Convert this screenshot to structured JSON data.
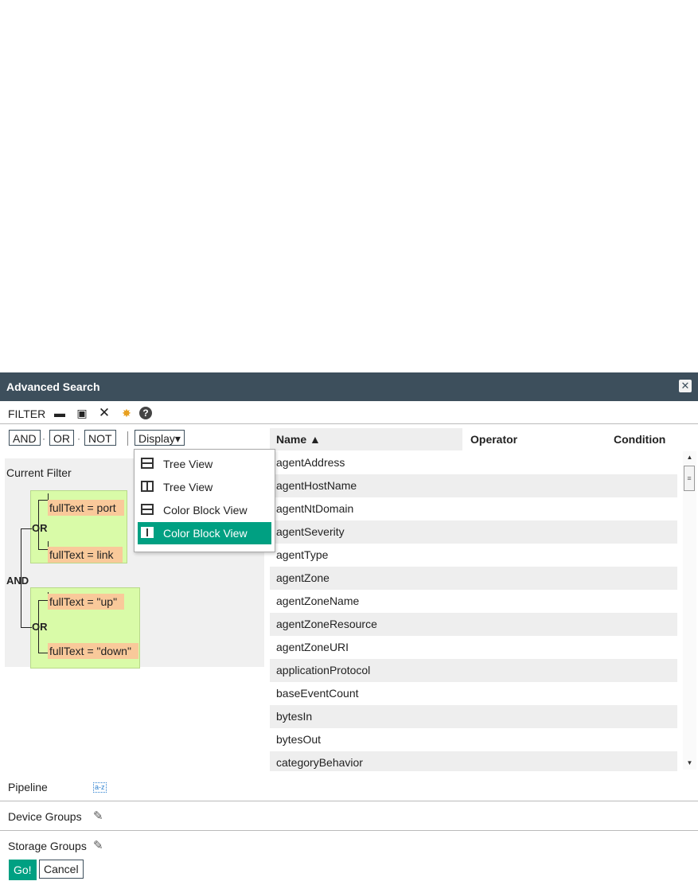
{
  "dialog": {
    "title": "Advanced Search",
    "close_icon": "close-icon"
  },
  "filterbar": {
    "label": "FILTER",
    "icons": [
      "folder-open-icon",
      "save-icon",
      "clear-icon",
      "magic-wand-icon",
      "help-icon"
    ]
  },
  "operators": {
    "and_label": "AND",
    "or_label": "OR",
    "not_label": "NOT",
    "display_label": "Display▾"
  },
  "display_menu": {
    "items": [
      {
        "label": "Tree View",
        "icon": "horizontal-layout-icon"
      },
      {
        "label": "Tree View",
        "icon": "vertical-layout-icon"
      },
      {
        "label": "Color Block View",
        "icon": "horizontal-layout-icon"
      },
      {
        "label": "Color Block View",
        "icon": "vertical-layout-icon",
        "selected": true
      }
    ]
  },
  "current_filter": {
    "label": "Current Filter",
    "root_op": "AND",
    "groups": [
      {
        "op": "OR",
        "leaves": [
          "fullText = port",
          "fullText = link"
        ]
      },
      {
        "op": "OR",
        "leaves": [
          "fullText = \"up\"",
          "fullText = \"down\""
        ]
      }
    ]
  },
  "table": {
    "columns": [
      "Name ▲",
      "Operator",
      "Condition"
    ],
    "rows": [
      "agentAddress",
      "agentHostName",
      "agentNtDomain",
      "agentSeverity",
      "agentType",
      "agentZone",
      "agentZoneName",
      "agentZoneResource",
      "agentZoneURI",
      "applicationProtocol",
      "baseEventCount",
      "bytesIn",
      "bytesOut",
      "categoryBehavior"
    ]
  },
  "sections": {
    "pipeline": "Pipeline",
    "pipeline_icon_text": "a-z",
    "device_groups": "Device Groups",
    "storage_groups": "Storage Groups"
  },
  "actions": {
    "go_label": "Go!",
    "cancel_label": "Cancel"
  },
  "colors": {
    "titlebar": "#3d4f5c",
    "accent": "#00a082",
    "group_fill": "#d9fba8",
    "leaf_fill": "#f9c99a"
  }
}
